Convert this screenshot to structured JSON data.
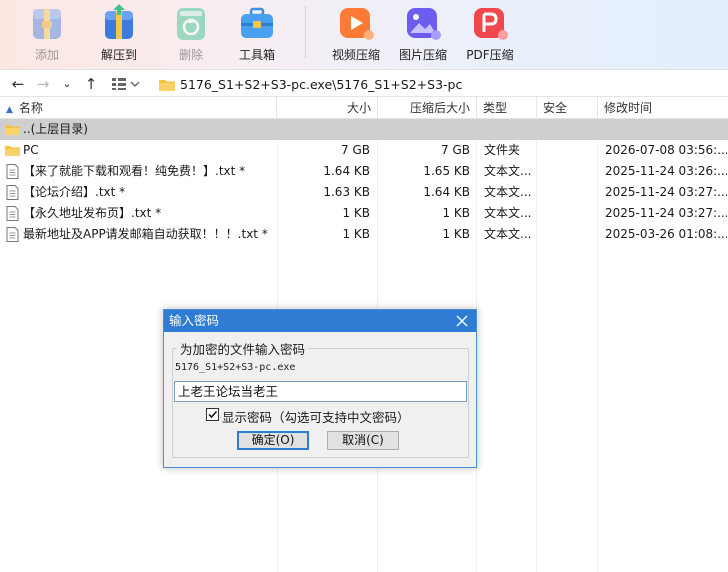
{
  "toolbar": {
    "add": "添加",
    "extract": "解压到",
    "delete": "删除",
    "tools": "工具箱",
    "video": "视频压缩",
    "image": "图片压缩",
    "pdf": "PDF压缩"
  },
  "address": {
    "path": "5176_S1+S2+S3-pc.exe\\5176_S1+S2+S3-pc"
  },
  "columns": {
    "name": "名称",
    "size": "大小",
    "packed": "压缩后大小",
    "type": "类型",
    "security": "安全",
    "modified": "修改时间"
  },
  "files": [
    {
      "name": "..(上层目录)",
      "size": "",
      "packed": "",
      "type": "",
      "modified": "",
      "kind": "parent"
    },
    {
      "name": "PC",
      "size": "7 GB",
      "packed": "7 GB",
      "type": "文件夹",
      "modified": "2026-07-08 03:56:...",
      "kind": "folder"
    },
    {
      "name": "【来了就能下载和观看！纯免费！】.txt *",
      "size": "1.64 KB",
      "packed": "1.65 KB",
      "type": "文本文...",
      "modified": "2025-11-24 03:26:...",
      "kind": "file"
    },
    {
      "name": "【论坛介绍】.txt *",
      "size": "1.63 KB",
      "packed": "1.64 KB",
      "type": "文本文...",
      "modified": "2025-11-24 03:27:...",
      "kind": "file"
    },
    {
      "name": "【永久地址发布页】.txt *",
      "size": "1 KB",
      "packed": "1 KB",
      "type": "文本文...",
      "modified": "2025-11-24 03:27:...",
      "kind": "file"
    },
    {
      "name": "最新地址及APP请发邮箱自动获取！！！.txt *",
      "size": "1 KB",
      "packed": "1 KB",
      "type": "文本文...",
      "modified": "2025-03-26 01:08:...",
      "kind": "file"
    }
  ],
  "dialog": {
    "title": "输入密码",
    "group_label": "为加密的文件输入密码",
    "archive_name": "5176_S1+S2+S3-pc.exe",
    "password_value": "上老王论坛当老王",
    "show_password_label": "显示密码（勾选可支持中文密码）",
    "show_password_checked": true,
    "ok_label": "确定(O)",
    "cancel_label": "取消(C)"
  }
}
